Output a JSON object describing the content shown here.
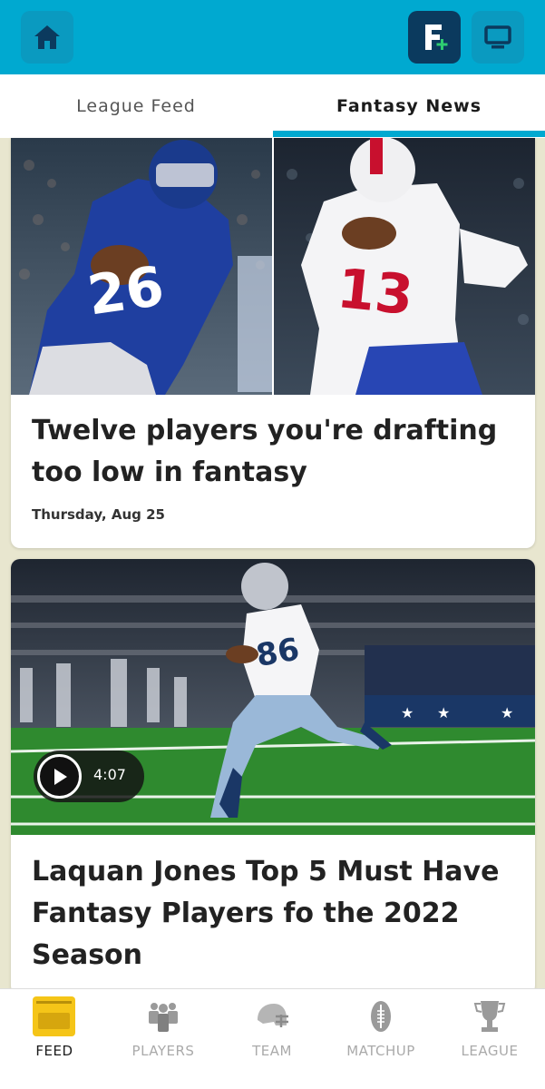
{
  "header": {
    "home_icon": "home-icon",
    "fantasy_plus_icon": "fantasy-plus-icon",
    "screen_icon": "monitor-icon"
  },
  "tabs": [
    {
      "label": "League Feed",
      "active": false
    },
    {
      "label": "Fantasy News",
      "active": true
    }
  ],
  "articles": [
    {
      "title": "Twelve players you're drafting too low in fantasy",
      "date": "Thursday, Aug 25",
      "image": "two-football-players-photo"
    },
    {
      "title": "Laquan Jones Top 5 Must Have Fantasy Players fo the 2022 Season",
      "image": "football-player-running-photo",
      "video_duration": "4:07"
    }
  ],
  "bottom_nav": [
    {
      "label": "FEED",
      "icon": "feed-icon",
      "active": true
    },
    {
      "label": "PLAYERS",
      "icon": "players-icon",
      "active": false
    },
    {
      "label": "TEAM",
      "icon": "helmet-icon",
      "active": false
    },
    {
      "label": "MATCHUP",
      "icon": "football-icon",
      "active": false
    },
    {
      "label": "LEAGUE",
      "icon": "trophy-icon",
      "active": false
    }
  ],
  "colors": {
    "accent": "#00a9d0",
    "navy": "#0b3a5e",
    "feed_yellow": "#f5c518"
  }
}
